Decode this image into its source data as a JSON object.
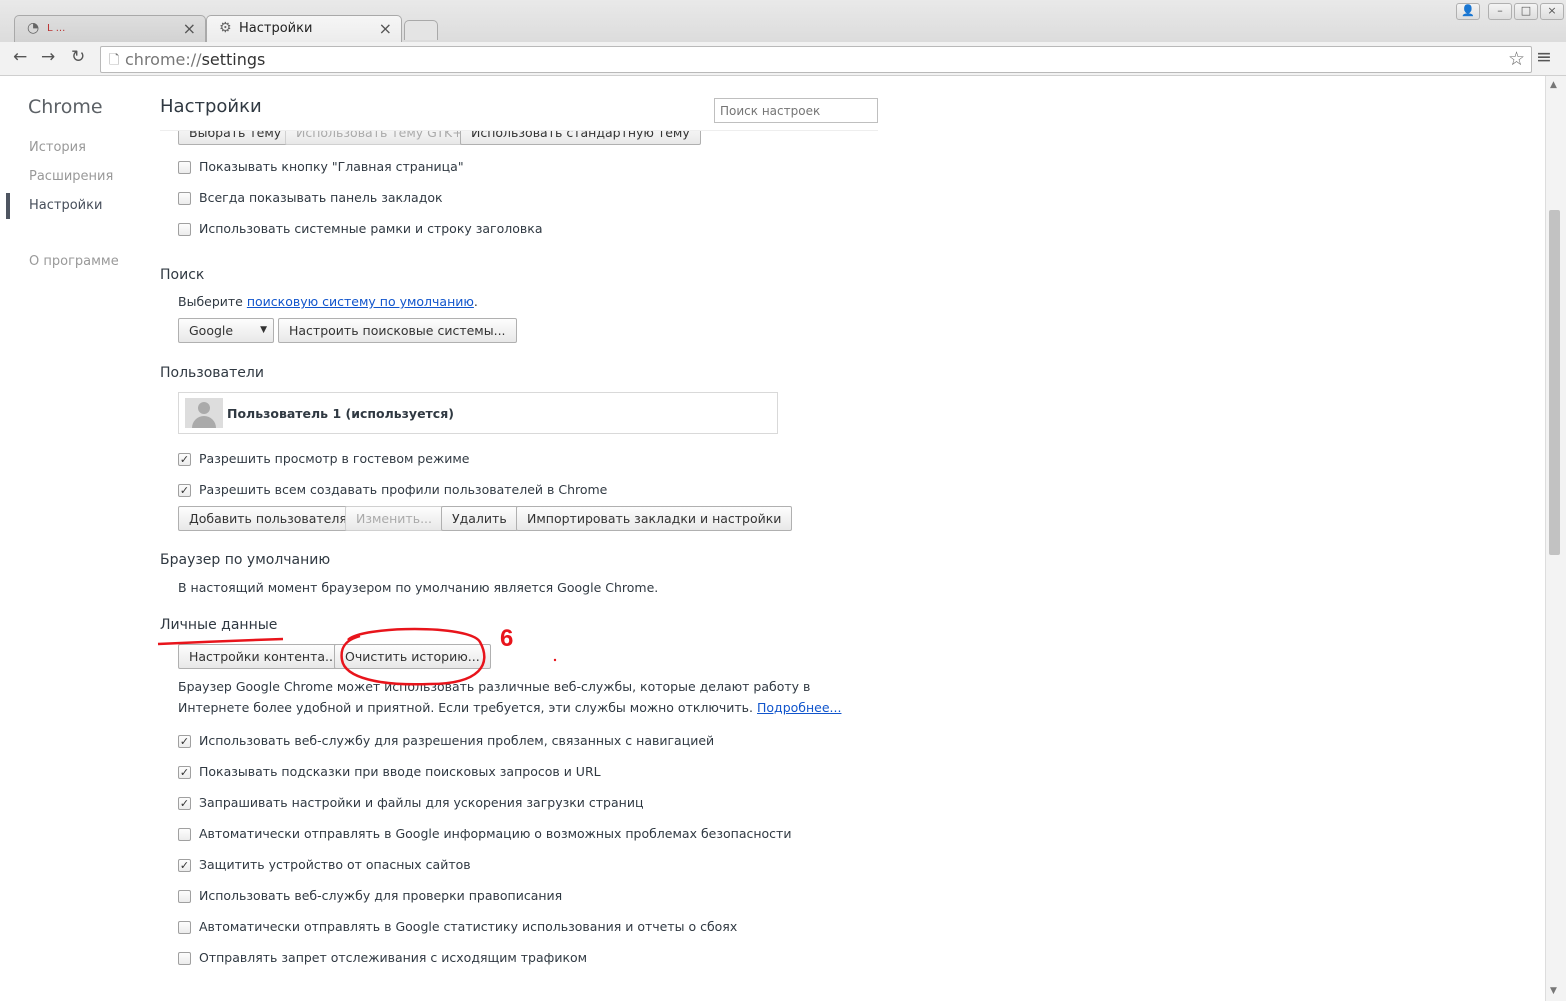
{
  "tabs": [
    {
      "title": "L ...",
      "close": "×"
    },
    {
      "title": "Настройки",
      "close": "×"
    }
  ],
  "toolbar": {
    "back": "←",
    "forward": "→",
    "reload": "↻",
    "url_scheme": "chrome://",
    "url_path": "settings",
    "star": "☆",
    "menu": "≡"
  },
  "sidebar": {
    "brand": "Chrome",
    "items": [
      "История",
      "Расширения",
      "Настройки",
      "О программе"
    ]
  },
  "main": {
    "title": "Настройки",
    "search_placeholder": "Поиск настроек",
    "theme_buttons": [
      "Выбрать тему",
      "Использовать тему GTK+",
      "Использовать стандартную тему"
    ],
    "appearance_checks": [
      {
        "label": "Показывать кнопку \"Главная страница\"",
        "checked": false
      },
      {
        "label": "Всегда показывать панель закладок",
        "checked": false
      },
      {
        "label": "Использовать системные рамки и строку заголовка",
        "checked": false
      }
    ],
    "search": {
      "heading": "Поиск",
      "text_before": "Выберите ",
      "link": "поисковую систему по умолчанию",
      "text_after": ".",
      "engine": "Google",
      "manage_button": "Настроить поисковые системы..."
    },
    "users": {
      "heading": "Пользователи",
      "user_name": "Пользователь 1 (используется)",
      "checks": [
        {
          "label": "Разрешить просмотр в гостевом режиме",
          "checked": true
        },
        {
          "label": "Разрешить всем создавать профили пользователей в Chrome",
          "checked": true
        }
      ],
      "buttons": [
        "Добавить пользователя",
        "Изменить...",
        "Удалить",
        "Импортировать закладки и настройки"
      ]
    },
    "default_browser": {
      "heading": "Браузер по умолчанию",
      "text": "В настоящий момент браузером по умолчанию является Google Chrome."
    },
    "privacy": {
      "heading": "Личные данные",
      "content_button": "Настройки контента...",
      "clear_button": "Очистить историю...",
      "desc_line1": "Браузер Google Chrome может использовать различные веб-службы, которые делают работу в",
      "desc_line2": "Интернете более удобной и приятной. Если требуется, эти службы можно отключить. ",
      "more_link": "Подробнее...",
      "checks": [
        {
          "label": "Использовать веб-службу для разрешения проблем, связанных с навигацией",
          "checked": true
        },
        {
          "label": "Показывать подсказки при вводе поисковых запросов и URL",
          "checked": true
        },
        {
          "label": "Запрашивать настройки и файлы для ускорения загрузки страниц",
          "checked": true
        },
        {
          "label": "Автоматически отправлять в Google информацию о возможных проблемах безопасности",
          "checked": false
        },
        {
          "label": "Защитить устройство от опасных сайтов",
          "checked": true
        },
        {
          "label": "Использовать веб-службу для проверки правописания",
          "checked": false
        },
        {
          "label": "Автоматически отправлять в Google статистику использования и отчеты о сбоях",
          "checked": false
        },
        {
          "label": "Отправлять запрет отслеживания с исходящим трафиком",
          "checked": false
        }
      ]
    },
    "annotation_number": "6"
  },
  "colors": {
    "annotation": "#e8141b",
    "link": "#1155cc"
  }
}
